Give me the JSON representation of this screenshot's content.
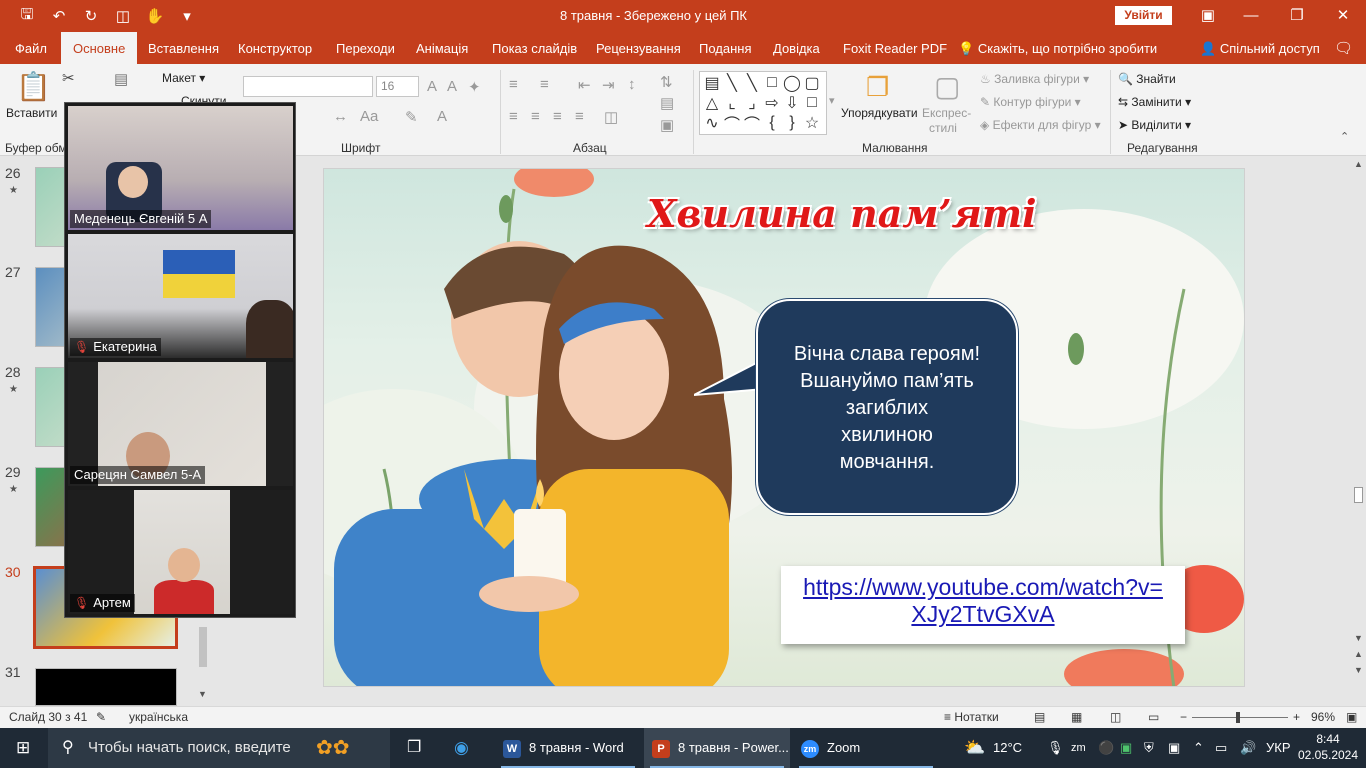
{
  "titlebar": {
    "doc_title": "8 травня  -  Збережено у цей ПК",
    "signin": "Увійти",
    "icons": [
      "save-icon",
      "undo-icon",
      "redo-icon",
      "present-icon",
      "touch-mode-icon",
      "customize-qat-icon"
    ]
  },
  "tabs": [
    {
      "label": "Файл"
    },
    {
      "label": "Основне",
      "active": true
    },
    {
      "label": "Вставлення"
    },
    {
      "label": "Конструктор"
    },
    {
      "label": "Переходи"
    },
    {
      "label": "Анімація"
    },
    {
      "label": "Показ слайдів"
    },
    {
      "label": "Рецензування"
    },
    {
      "label": "Подання"
    },
    {
      "label": "Довідка"
    },
    {
      "label": "Foxit Reader PDF"
    }
  ],
  "tellme": "Скажіть, що потрібно зробити",
  "share": "Спільний доступ",
  "ribbon": {
    "paste": "Вставити",
    "layout": "Макет",
    "reset": "Скинути",
    "font_size": "16",
    "groups": {
      "clipboard": "Буфер обмі",
      "font": "Шрифт",
      "paragraph": "Абзац",
      "drawing": "Малювання",
      "editing": "Редагування"
    },
    "arrange": "Упорядкувати",
    "quick_styles": "Експрес-стилі",
    "quick_styles_line1": "Експрес-",
    "quick_styles_line2": "стилі",
    "shape_fill": "Заливка фігури",
    "shape_outline": "Контур фігури",
    "shape_effects": "Ефекти для фігур",
    "find": "Знайти",
    "replace": "Замінити",
    "select": "Виділити"
  },
  "thumbnails": [
    {
      "num": "26",
      "star": true
    },
    {
      "num": "27",
      "star": false
    },
    {
      "num": "28",
      "star": true
    },
    {
      "num": "29",
      "star": true
    },
    {
      "num": "30",
      "star": false,
      "current": true
    },
    {
      "num": "31",
      "star": false
    }
  ],
  "zoom": {
    "participants": [
      {
        "name": "Меденець Євгеній 5 А",
        "muted": false
      },
      {
        "name": "Екатерина",
        "muted": true
      },
      {
        "name": "Сарецян Самвел 5-А",
        "muted": false
      },
      {
        "name": "Артем",
        "muted": true
      }
    ]
  },
  "slide": {
    "title": "Хвилина пам’яті",
    "bubble_lines": [
      "Вічна слава героям!",
      "Вшануймо пам’ять",
      "загиблих",
      "хвилиною",
      "мовчання."
    ],
    "link_line1": "https://www.youtube.com/watch?v=",
    "link_line2": "XJy2TtvGXvA"
  },
  "statusbar": {
    "slide_info": "Слайд 30 з 41",
    "language": "українська",
    "notes": "Нотатки",
    "zoom": "96%"
  },
  "taskbar": {
    "search_placeholder": "Чтобы начать поиск, введите",
    "apps": [
      {
        "label": "8 травня - Word",
        "badge": "W"
      },
      {
        "label": "8 травня - Power...",
        "badge": "P",
        "active": true
      },
      {
        "label": "Zoom",
        "badge": "zm"
      }
    ],
    "weather": "12°C",
    "lang": "УКР",
    "time": "8:44",
    "date": "02.05.2024"
  }
}
